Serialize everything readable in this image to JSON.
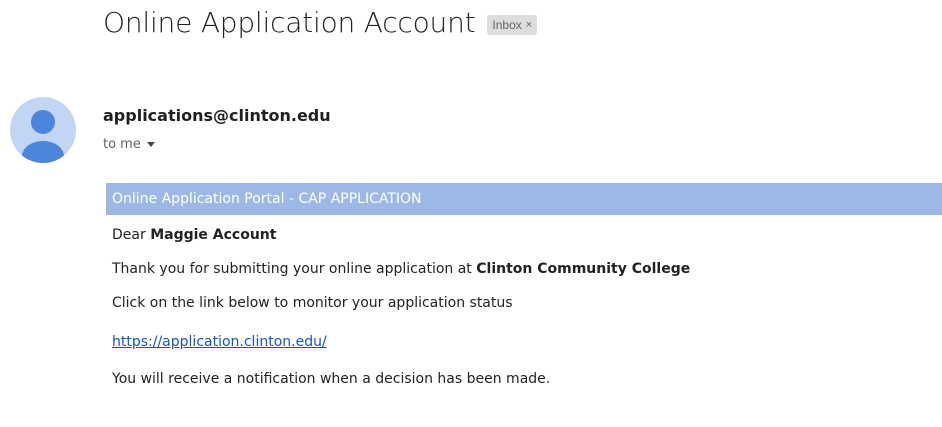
{
  "email": {
    "subject": "Online Application Account",
    "label": "Inbox",
    "label_remove": "×",
    "sender": "applications@clinton.edu",
    "recipient": "to me"
  },
  "body": {
    "banner": "Online Application Portal - CAP APPLICATION",
    "greeting_prefix": "Dear ",
    "greeting_name": "Maggie Account",
    "thanks_prefix": "Thank you for submitting your online application at ",
    "college_name": "Clinton Community College",
    "instruction": "Click on the link below to monitor your application status",
    "link": "https://application.clinton.edu/",
    "notification": "You will receive a notification when a decision has been made."
  },
  "colors": {
    "banner_bg": "#9cb9e6",
    "link": "#1155cc",
    "avatar_bg": "#c2d6f3",
    "avatar_fg": "#4b85de"
  },
  "icons": {
    "avatar": "default-user-avatar-icon",
    "label_close": "close-icon",
    "recipient_menu": "caret-down-icon"
  }
}
